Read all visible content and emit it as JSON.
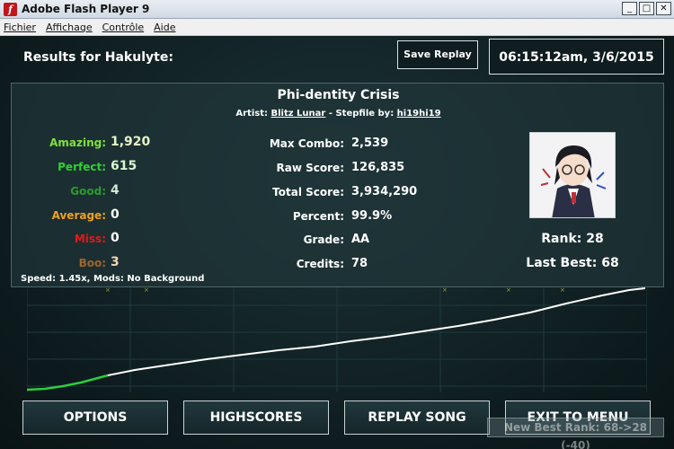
{
  "window": {
    "title": "Adobe Flash Player 9",
    "menu": [
      "Fichier",
      "Affichage",
      "Contrôle",
      "Aide"
    ]
  },
  "header": {
    "results_label": "Results for Hakulyte:",
    "save_replay_label": "Save Replay",
    "datetime": "06:15:12am, 3/6/2015"
  },
  "song": {
    "title": "Phi-dentity Crisis",
    "artist_prefix": "Artist:",
    "artist": "Blitz Lunar",
    "separator": " - ",
    "stepfile_prefix": "Stepfile by:",
    "stepfile": "hi19hi19"
  },
  "judgements": [
    {
      "label": "Amazing:",
      "value": "1,920",
      "color": "#7fe23a"
    },
    {
      "label": "Perfect:",
      "value": "615",
      "color": "#2fd12f"
    },
    {
      "label": "Good:",
      "value": "4",
      "color": "#2a9c2a"
    },
    {
      "label": "Average:",
      "value": "0",
      "color": "#f0a020"
    },
    {
      "label": "Miss:",
      "value": "0",
      "color": "#e01a1a"
    },
    {
      "label": "Boo:",
      "value": "3",
      "color": "#a0642a"
    }
  ],
  "stats": [
    {
      "label": "Max Combo:",
      "value": "2,539"
    },
    {
      "label": "Raw Score:",
      "value": "126,835"
    },
    {
      "label": "Total Score:",
      "value": "3,934,290"
    },
    {
      "label": "Percent:",
      "value": "99.9%"
    },
    {
      "label": "Grade:",
      "value": "AA"
    },
    {
      "label": "Credits:",
      "value": "78"
    }
  ],
  "speed_mods": "Speed: 1.45x, Mods: No Background",
  "rank": {
    "text": "Rank: 28",
    "last_best": "Last Best: 68"
  },
  "buttons": {
    "options": "OPTIONS",
    "highscores": "HIGHSCORES",
    "replay": "REPLAY SONG",
    "exit": "EXIT TO MENU"
  },
  "toast": "New Best Rank: 68->28 (-40)",
  "colors": {
    "accent": "#ffffff",
    "graph_early": "#2ecc40",
    "graph_line": "#ffffff",
    "miss_mark": "#9aa63a"
  }
}
